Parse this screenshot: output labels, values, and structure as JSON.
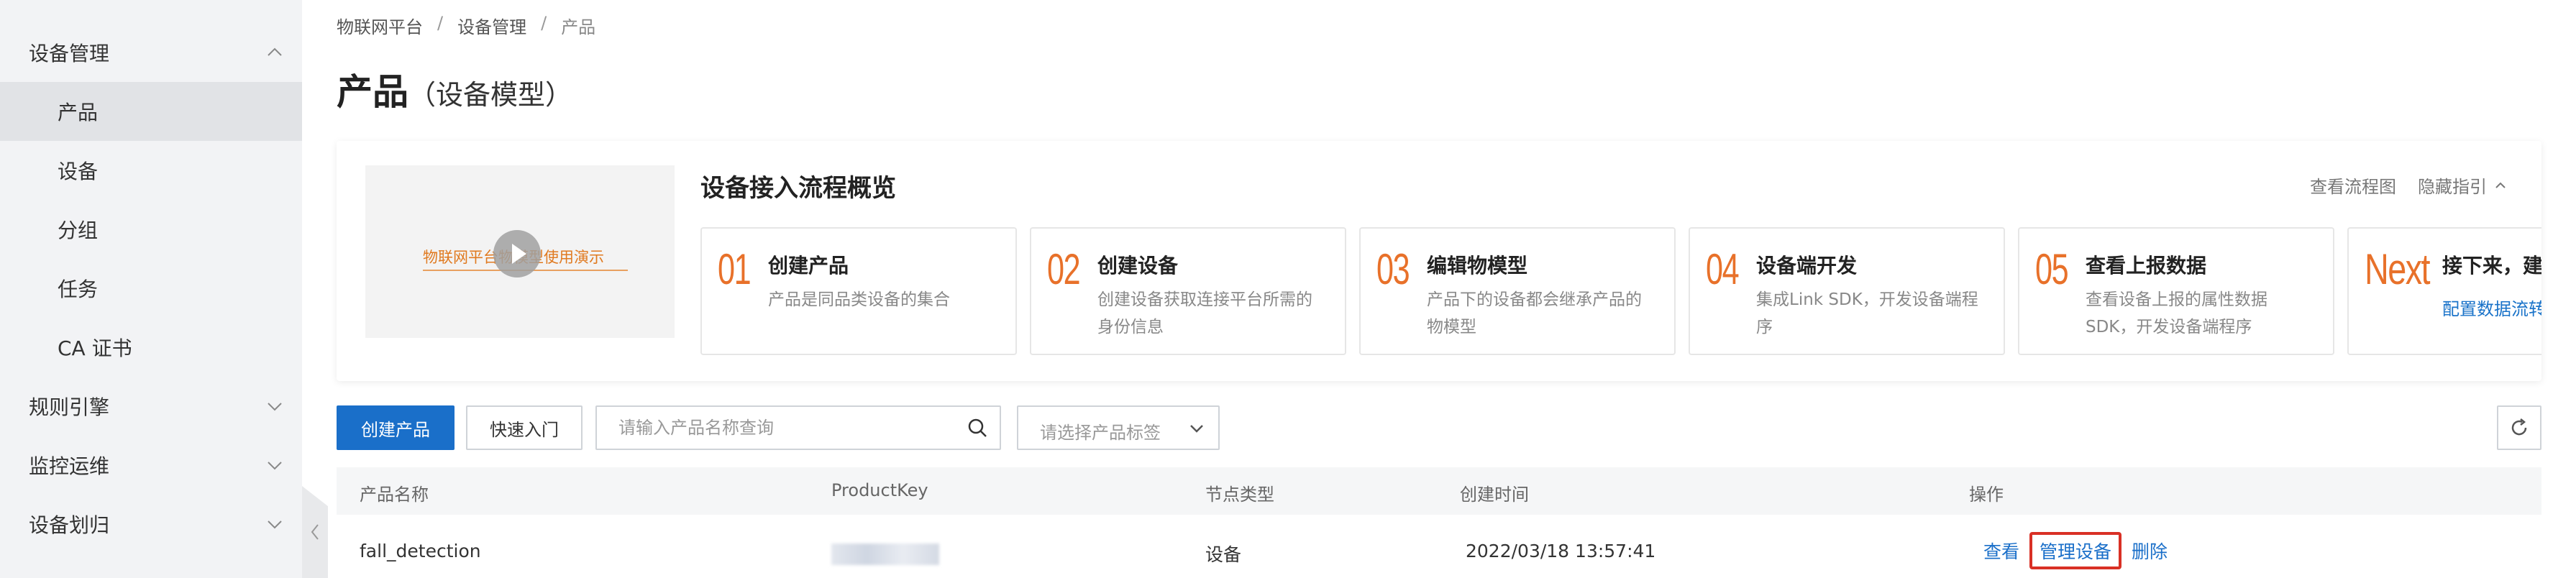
{
  "sidebar": {
    "items": [
      {
        "label": "设备管理",
        "expanded": true
      },
      {
        "label": "产品",
        "active": true
      },
      {
        "label": "设备"
      },
      {
        "label": "分组"
      },
      {
        "label": "任务"
      },
      {
        "label": "CA 证书"
      },
      {
        "label": "规则引擎"
      },
      {
        "label": "监控运维"
      },
      {
        "label": "设备划归"
      }
    ]
  },
  "breadcrumb": [
    "物联网平台",
    "设备管理",
    "产品"
  ],
  "page": {
    "title": "产品",
    "subtitle": "（设备模型）"
  },
  "guide": {
    "video_text": "物联网平台物模型使用演示",
    "title": "设备接入流程概览",
    "view_flow": "查看流程图",
    "hide_guide": "隐藏指引",
    "steps": [
      {
        "num": "01",
        "title": "创建产品",
        "desc": "产品是同品类设备的集合"
      },
      {
        "num": "02",
        "title": "创建设备",
        "desc": "创建设备获取连接平台所需的身份信息"
      },
      {
        "num": "03",
        "title": "编辑物模型",
        "desc": "产品下的设备都会继承产品的物模型"
      },
      {
        "num": "04",
        "title": "设备端开发",
        "desc": "集成Link SDK，开发设备端程序"
      },
      {
        "num": "05",
        "title": "查看上报数据",
        "desc": "查看设备上报的属性数据SDK，开发设备端程序"
      },
      {
        "num": "Next",
        "title": "接下来，建",
        "link": "配置数据流转"
      }
    ]
  },
  "toolbar": {
    "create_label": "创建产品",
    "quick_start_label": "快速入门",
    "search_placeholder": "请输入产品名称查询",
    "tag_placeholder": "请选择产品标签"
  },
  "table": {
    "columns": [
      "产品名称",
      "ProductKey",
      "节点类型",
      "创建时间",
      "操作"
    ],
    "rows": [
      {
        "name": "fall_detection",
        "node_type": "设备",
        "created": "2022/03/18 13:57:41",
        "actions": [
          "查看",
          "管理设备",
          "删除"
        ]
      }
    ]
  },
  "colors": {
    "accent": "#1a6fc9",
    "step_number": "#e8712a",
    "highlight_border": "#d93025"
  }
}
